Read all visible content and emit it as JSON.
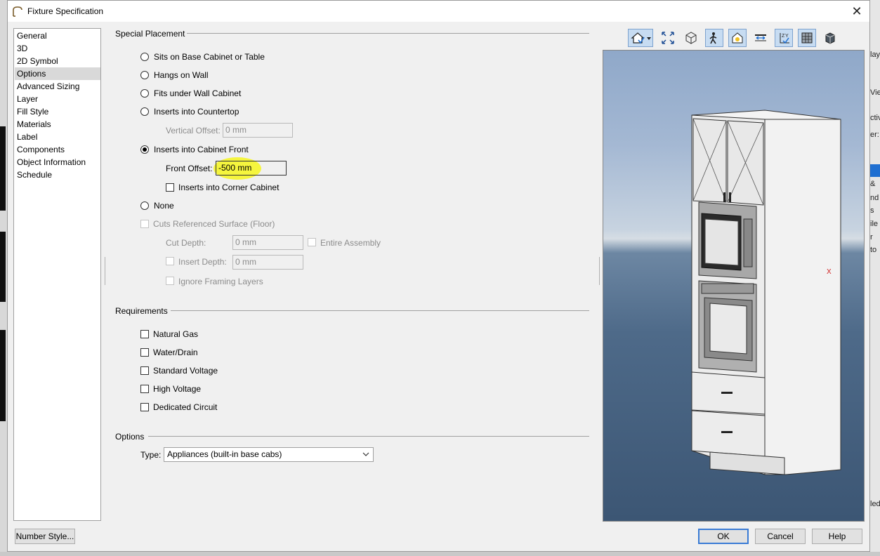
{
  "dialog": {
    "title": "Fixture Specification",
    "close_label": "✕"
  },
  "nav": {
    "items": [
      "General",
      "3D",
      "2D Symbol",
      "Options",
      "Advanced Sizing",
      "Layer",
      "Fill Style",
      "Materials",
      "Label",
      "Components",
      "Object Information",
      "Schedule"
    ],
    "selected": "Options"
  },
  "special_placement": {
    "title": "Special Placement",
    "sits_on_base": "Sits on Base Cabinet or Table",
    "hangs_on_wall": "Hangs on Wall",
    "fits_under_wall": "Fits under Wall Cabinet",
    "inserts_countertop": "Inserts into Countertop",
    "vertical_offset_label": "Vertical Offset:",
    "vertical_offset_value": "0 mm",
    "inserts_cabinet_front": "Inserts into Cabinet Front",
    "front_offset_label": "Front Offset:",
    "front_offset_value": "-500 mm",
    "inserts_corner": "Inserts into Corner Cabinet",
    "none": "None",
    "cuts_surface": "Cuts Referenced Surface (Floor)",
    "cut_depth_label": "Cut Depth:",
    "cut_depth_value": "0 mm",
    "entire_assembly": "Entire Assembly",
    "insert_depth_label": "Insert Depth:",
    "insert_depth_value": "0 mm",
    "ignore_framing": "Ignore Framing Layers",
    "selected_option": "Inserts into Cabinet Front"
  },
  "requirements": {
    "title": "Requirements",
    "items": [
      "Natural Gas",
      "Water/Drain",
      "Standard Voltage",
      "High Voltage",
      "Dedicated Circuit"
    ]
  },
  "options": {
    "title": "Options",
    "type_label": "Type:",
    "type_value": "Appliances (built-in base cabs)"
  },
  "buttons": {
    "number_style": "Number Style...",
    "ok": "OK",
    "cancel": "Cancel",
    "help": "Help"
  },
  "toolbar": {
    "icons": [
      "camera-view-icon",
      "fill-window-icon",
      "render-mode-icon",
      "walkthrough-icon",
      "lighting-icon",
      "dimension-icon",
      "axes-icon",
      "materials-icon",
      "cube-icon"
    ]
  },
  "preview": {
    "axis_label": "X"
  },
  "background": {
    "right_fragments": [
      "lay",
      "Vie",
      "ctiv",
      "er:",
      "&",
      "nd",
      "s",
      "ile",
      "r",
      "to",
      "led"
    ]
  },
  "colors": {
    "accent": "#3a7bd5",
    "highlight": "#f5f52a"
  }
}
